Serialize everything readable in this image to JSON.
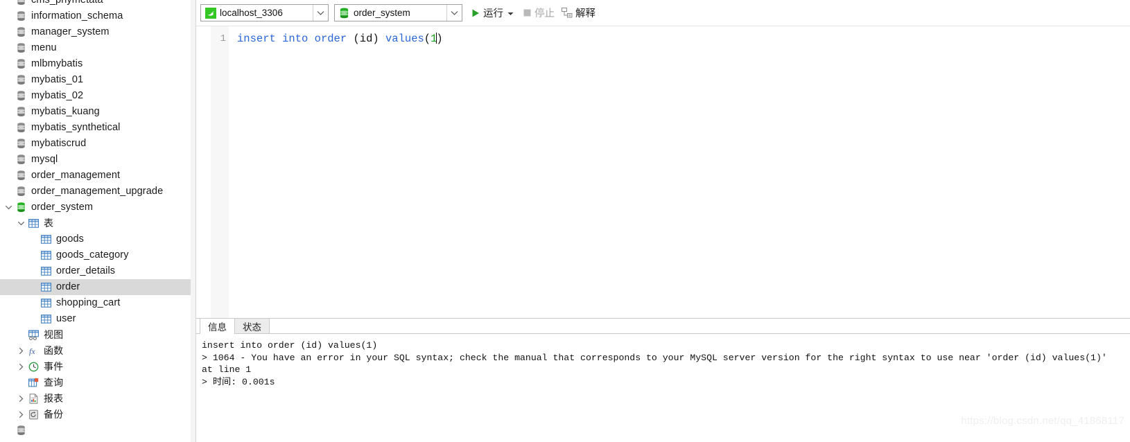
{
  "sidebar": {
    "scrollbar": {
      "name": "sidebar-vertical-scrollbar"
    },
    "items": [
      {
        "label": "cms_phymetata",
        "icon": "database-icon",
        "depth": 0,
        "twisty": "none",
        "selected": false,
        "partial": true
      },
      {
        "label": "information_schema",
        "icon": "database-icon",
        "depth": 0,
        "twisty": "none",
        "selected": false
      },
      {
        "label": "manager_system",
        "icon": "database-icon",
        "depth": 0,
        "twisty": "none",
        "selected": false
      },
      {
        "label": "menu",
        "icon": "database-icon",
        "depth": 0,
        "twisty": "none",
        "selected": false
      },
      {
        "label": "mlbmybatis",
        "icon": "database-icon",
        "depth": 0,
        "twisty": "none",
        "selected": false
      },
      {
        "label": "mybatis_01",
        "icon": "database-icon",
        "depth": 0,
        "twisty": "none",
        "selected": false
      },
      {
        "label": "mybatis_02",
        "icon": "database-icon",
        "depth": 0,
        "twisty": "none",
        "selected": false
      },
      {
        "label": "mybatis_kuang",
        "icon": "database-icon",
        "depth": 0,
        "twisty": "none",
        "selected": false
      },
      {
        "label": "mybatis_synthetical",
        "icon": "database-icon",
        "depth": 0,
        "twisty": "none",
        "selected": false
      },
      {
        "label": "mybatiscrud",
        "icon": "database-icon",
        "depth": 0,
        "twisty": "none",
        "selected": false
      },
      {
        "label": "mysql",
        "icon": "database-icon",
        "depth": 0,
        "twisty": "none",
        "selected": false
      },
      {
        "label": "order_management",
        "icon": "database-icon",
        "depth": 0,
        "twisty": "none",
        "selected": false
      },
      {
        "label": "order_management_upgrade",
        "icon": "database-icon",
        "depth": 0,
        "twisty": "none",
        "selected": false
      },
      {
        "label": "order_system",
        "icon": "database-icon-green",
        "depth": 0,
        "twisty": "expanded",
        "selected": false
      },
      {
        "label": "表",
        "icon": "table-folder-icon",
        "depth": 1,
        "twisty": "expanded",
        "selected": false
      },
      {
        "label": "goods",
        "icon": "table-icon",
        "depth": 2,
        "twisty": "none",
        "selected": false
      },
      {
        "label": "goods_category",
        "icon": "table-icon",
        "depth": 2,
        "twisty": "none",
        "selected": false
      },
      {
        "label": "order_details",
        "icon": "table-icon",
        "depth": 2,
        "twisty": "none",
        "selected": false
      },
      {
        "label": "order",
        "icon": "table-icon",
        "depth": 2,
        "twisty": "none",
        "selected": true
      },
      {
        "label": "shopping_cart",
        "icon": "table-icon",
        "depth": 2,
        "twisty": "none",
        "selected": false
      },
      {
        "label": "user",
        "icon": "table-icon",
        "depth": 2,
        "twisty": "none",
        "selected": false
      },
      {
        "label": "视图",
        "icon": "view-icon",
        "depth": 1,
        "twisty": "none",
        "selected": false
      },
      {
        "label": "函数",
        "icon": "function-icon",
        "depth": 1,
        "twisty": "collapsed",
        "selected": false
      },
      {
        "label": "事件",
        "icon": "event-clock-icon",
        "depth": 1,
        "twisty": "collapsed",
        "selected": false
      },
      {
        "label": "查询",
        "icon": "query-icon",
        "depth": 1,
        "twisty": "none",
        "selected": false
      },
      {
        "label": "报表",
        "icon": "report-icon",
        "depth": 1,
        "twisty": "collapsed",
        "selected": false
      },
      {
        "label": "备份",
        "icon": "backup-icon",
        "depth": 1,
        "twisty": "collapsed",
        "selected": false
      },
      {
        "label": "",
        "icon": "database-icon",
        "depth": 0,
        "twisty": "none",
        "selected": false,
        "partial": true
      }
    ]
  },
  "toolbar": {
    "connection": {
      "value": "localhost_3306",
      "icon": "mysql-dolphin-icon"
    },
    "database": {
      "value": "order_system",
      "icon": "database-icon-green"
    },
    "run": {
      "label": "运行",
      "icon": "play-icon",
      "caret": "▾"
    },
    "stop": {
      "label": "停止",
      "icon": "stop-square-icon",
      "disabled": true
    },
    "explain": {
      "label": "解释",
      "icon": "explain-icon"
    }
  },
  "editor": {
    "line_number": "1",
    "code": {
      "kw1": "insert",
      "kw2": "into",
      "kw3": "order",
      "mid": " (id) ",
      "kw4": "values",
      "paren_open": "(",
      "number": "1",
      "paren_close": ")"
    },
    "full_text": "insert into order (id) values(1)"
  },
  "bottom_panel": {
    "tabs": [
      {
        "label": "信息",
        "active": true
      },
      {
        "label": "状态",
        "active": false
      }
    ],
    "message_lines": [
      "insert into order (id) values(1)",
      "> 1064 - You have an error in your SQL syntax; check the manual that corresponds to your MySQL server version for the right syntax to use near 'order (id) values(1)'",
      "at line 1",
      "> 时间: 0.001s"
    ]
  },
  "watermark": {
    "text": "https://blog.csdn.net/qq_41868117"
  },
  "colors": {
    "accent_green": "#26a426",
    "keyword_blue": "#2a66d9",
    "number_green": "#1aa11a",
    "selection_gray": "#d9d9d9",
    "table_icon_blue": "#3f7fc1"
  }
}
